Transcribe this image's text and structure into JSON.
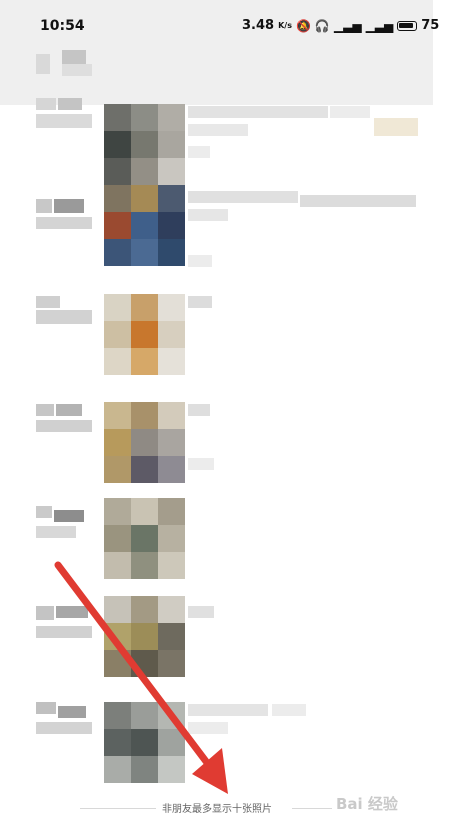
{
  "status_bar": {
    "time": "10:54",
    "net_speed": "3.48",
    "net_unit": "K/s",
    "battery": "75",
    "icons": [
      "mute-icon",
      "headphones-icon",
      "signal-icon",
      "signal-icon",
      "battery-icon"
    ]
  },
  "footer": {
    "notice": "非朋友最多显示十张照片"
  },
  "watermark": {
    "text": "Bai 经验"
  },
  "annotation": {
    "arrow_color": "#e03b32"
  }
}
